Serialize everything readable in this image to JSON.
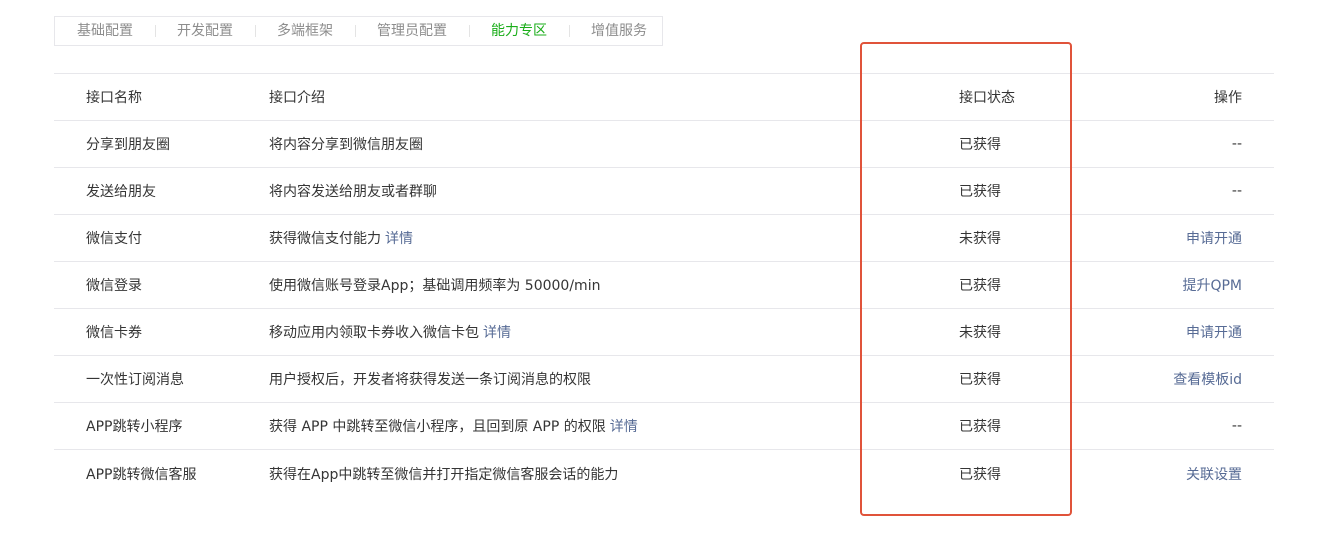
{
  "tabs": [
    {
      "label": "基础配置",
      "active": false
    },
    {
      "label": "开发配置",
      "active": false
    },
    {
      "label": "多端框架",
      "active": false
    },
    {
      "label": "管理员配置",
      "active": false
    },
    {
      "label": "能力专区",
      "active": true
    },
    {
      "label": "增值服务",
      "active": false
    }
  ],
  "table": {
    "headers": {
      "name": "接口名称",
      "desc": "接口介绍",
      "status": "接口状态",
      "op": "操作"
    },
    "rows": [
      {
        "name": "分享到朋友圈",
        "desc": "将内容分享到微信朋友圈",
        "detail": "",
        "status": "已获得",
        "op": "--",
        "op_link": false
      },
      {
        "name": "发送给朋友",
        "desc": "将内容发送给朋友或者群聊",
        "detail": "",
        "status": "已获得",
        "op": "--",
        "op_link": false
      },
      {
        "name": "微信支付",
        "desc": "获得微信支付能力",
        "detail": "详情",
        "status": "未获得",
        "op": "申请开通",
        "op_link": true
      },
      {
        "name": "微信登录",
        "desc": "使用微信账号登录App；基础调用频率为 50000/min",
        "detail": "",
        "status": "已获得",
        "op": "提升QPM",
        "op_link": true
      },
      {
        "name": "微信卡券",
        "desc": "移动应用内领取卡券收入微信卡包",
        "detail": "详情",
        "status": "未获得",
        "op": "申请开通",
        "op_link": true
      },
      {
        "name": "一次性订阅消息",
        "desc": "用户授权后，开发者将获得发送一条订阅消息的权限",
        "detail": "",
        "status": "已获得",
        "op": "查看模板id",
        "op_link": true
      },
      {
        "name": "APP跳转小程序",
        "desc": "获得 APP 中跳转至微信小程序，且回到原 APP 的权限",
        "detail": "详情",
        "status": "已获得",
        "op": "--",
        "op_link": false
      },
      {
        "name": "APP跳转微信客服",
        "desc": "获得在App中跳转至微信并打开指定微信客服会话的能力",
        "detail": "",
        "status": "已获得",
        "op": "关联设置",
        "op_link": true
      }
    ]
  },
  "colors": {
    "accent_active_tab": "#1aad19",
    "link": "#576b95",
    "highlight_border": "#e0533a"
  }
}
